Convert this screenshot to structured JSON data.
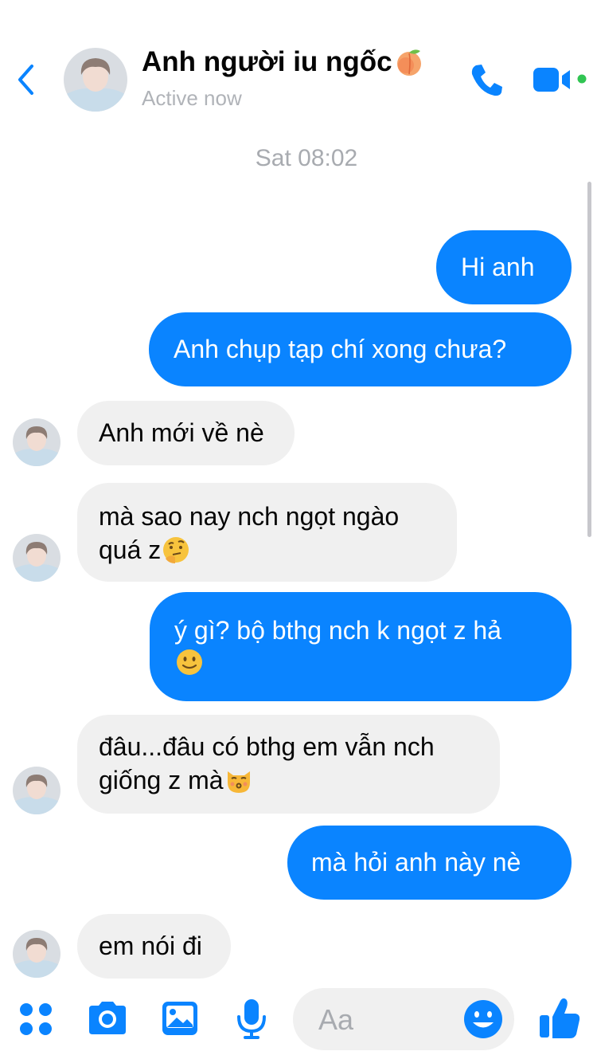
{
  "header": {
    "contact_name": "Anh người iu ngốc",
    "status": "Active now",
    "icons": {
      "back": "chevron-left-icon",
      "call": "phone-icon",
      "video": "video-camera-icon"
    }
  },
  "conversation": {
    "timestamp": "Sat 08:02",
    "messages": [
      {
        "from": "me",
        "text": "Hi anh"
      },
      {
        "from": "me",
        "text": "Anh chụp tạp chí xong chưa?"
      },
      {
        "from": "contact",
        "text": "Anh mới về nè"
      },
      {
        "from": "contact",
        "line1": "mà sao nay nch ngọt ngào",
        "line2": "quá z",
        "emoji": "thinking-face"
      },
      {
        "from": "me",
        "line1": "ý gì? bộ bthg nch k ngọt z hả",
        "emoji": "slightly-smiling-face"
      },
      {
        "from": "contact",
        "line1": "đâu...đâu có bthg em vẫn nch",
        "line2": "giống z mà",
        "emoji": "kissing-cat-face"
      },
      {
        "from": "me",
        "text": "mà hỏi anh này nè"
      },
      {
        "from": "contact",
        "text": "em nói đi"
      }
    ]
  },
  "composer": {
    "placeholder": "Aa",
    "icons": [
      "grid-menu-icon",
      "camera-icon",
      "photo-icon",
      "microphone-icon",
      "emoji-icon",
      "thumbs-up-icon"
    ]
  },
  "colors": {
    "accent": "#0a84ff",
    "incoming_bubble": "#f0f0f0",
    "online_dot": "#31c553",
    "muted_text": "#b0b3b8"
  }
}
